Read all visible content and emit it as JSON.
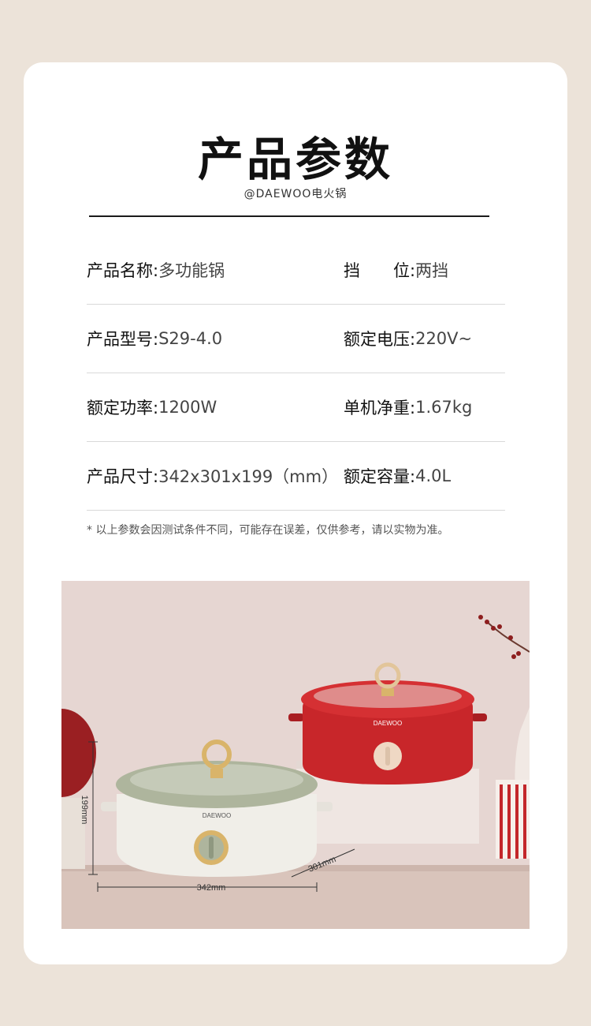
{
  "header": {
    "title": "产品参数",
    "subtitle": "@DAEWOO电火锅"
  },
  "specs": [
    {
      "left": {
        "label": "产品名称:",
        "value": "多功能锅"
      },
      "right": {
        "label": "挡　　位:",
        "value": "两挡"
      }
    },
    {
      "left": {
        "label": "产品型号:",
        "value": "S29-4.0"
      },
      "right": {
        "label": "额定电压:",
        "value": "220V~"
      }
    },
    {
      "left": {
        "label": "额定功率:",
        "value": "1200W"
      },
      "right": {
        "label": "单机净重:",
        "value": "1.67kg"
      }
    },
    {
      "left": {
        "label": "产品尺寸:",
        "value": "342x301x199（mm）"
      },
      "right": {
        "label": "额定容量:",
        "value": "4.0L"
      }
    }
  ],
  "note": "* 以上参数会因测试条件不同，可能存在误差，仅供参考，请以实物为准。",
  "photo": {
    "brand_logo": "DAEWOO",
    "dimensions": {
      "height": "199mm",
      "depth": "301mm",
      "width": "342mm"
    },
    "colors": {
      "red_pot": "#c8262a",
      "white_pot": "#efece4",
      "lid_green": "#aeb59d",
      "knob": "#d9b46a"
    }
  }
}
